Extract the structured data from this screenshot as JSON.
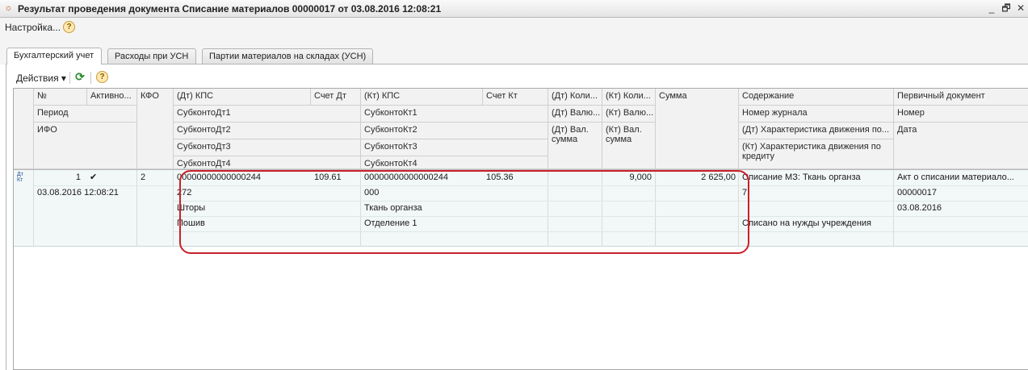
{
  "window": {
    "title": "Результат проведения документа Списание материалов 00000017 от 03.08.2016 12:08:21",
    "minimize": "_",
    "restore": "🗗",
    "close": "✕"
  },
  "menu": {
    "settings": "Настройка...",
    "help": "?"
  },
  "tabs": [
    {
      "label": "Бухгалтерский учет",
      "active": true
    },
    {
      "label": "Расходы при УСН",
      "active": false
    },
    {
      "label": "Партии материалов на складах (УСН)",
      "active": false
    }
  ],
  "toolbar": {
    "actions": "Действия ▾",
    "refresh": "⟳",
    "help": "?"
  },
  "table": {
    "headers": {
      "num": "№",
      "active": "Активно...",
      "kfo": "КФО",
      "period": "Период",
      "ifo": "ИФО",
      "dt_kps": "(Дт) КПС",
      "schet_dt": "Счет Дт",
      "subkonto_dt1": "СубконтоДт1",
      "subkonto_dt2": "СубконтоДт2",
      "subkonto_dt3": "СубконтоДт3",
      "subkonto_dt4": "СубконтоДт4",
      "kt_kps": "(Кт) КПС",
      "schet_kt": "Счет Кт",
      "subkonto_kt1": "СубконтоКт1",
      "subkonto_kt2": "СубконтоКт2",
      "subkonto_kt3": "СубконтоКт3",
      "subkonto_kt4": "СубконтоКт4",
      "dt_kol": "(Дт) Коли...",
      "dt_valyu": "(Дт) Валю...",
      "dt_val_summa": "(Дт) Вал. сумма",
      "kt_kol": "(Кт) Коли...",
      "kt_valyu": "(Кт) Валю...",
      "kt_val_summa": "(Кт) Вал. сумма",
      "summa": "Сумма",
      "soderzhanie": "Содержание",
      "nomer_zhurnala": "Номер журнала",
      "dt_harakter": "(Дт) Характеристика движения по...",
      "kt_harakter": "(Кт) Характеристика движения по кредиту",
      "perv_doc": "Первичный документ",
      "nomer": "Номер",
      "data": "Дата"
    },
    "row": {
      "icon": "Дт Кт",
      "num": "1",
      "active_check": "✔",
      "period": "03.08.2016 12:08:21",
      "kfo": "2",
      "dt_kps": "00000000000000244",
      "schet_dt": "109.61",
      "subkonto_dt1": "272",
      "subkonto_dt2": "Шторы",
      "subkonto_dt3": "Пошив",
      "kt_kps": "00000000000000244",
      "schet_kt": "105.36",
      "subkonto_kt1": "000",
      "subkonto_kt2": "Ткань органза",
      "subkonto_kt3": "Отделение 1",
      "kt_kol": "9,000",
      "summa": "2 625,00",
      "soderzhanie": "Списание МЗ: Ткань органза",
      "nomer_zhurnala": "7",
      "kt_harakter": "Списано на нужды учреждения",
      "perv_doc": "Акт о списании материало...",
      "nomer": "00000017",
      "data": "03.08.2016"
    }
  }
}
